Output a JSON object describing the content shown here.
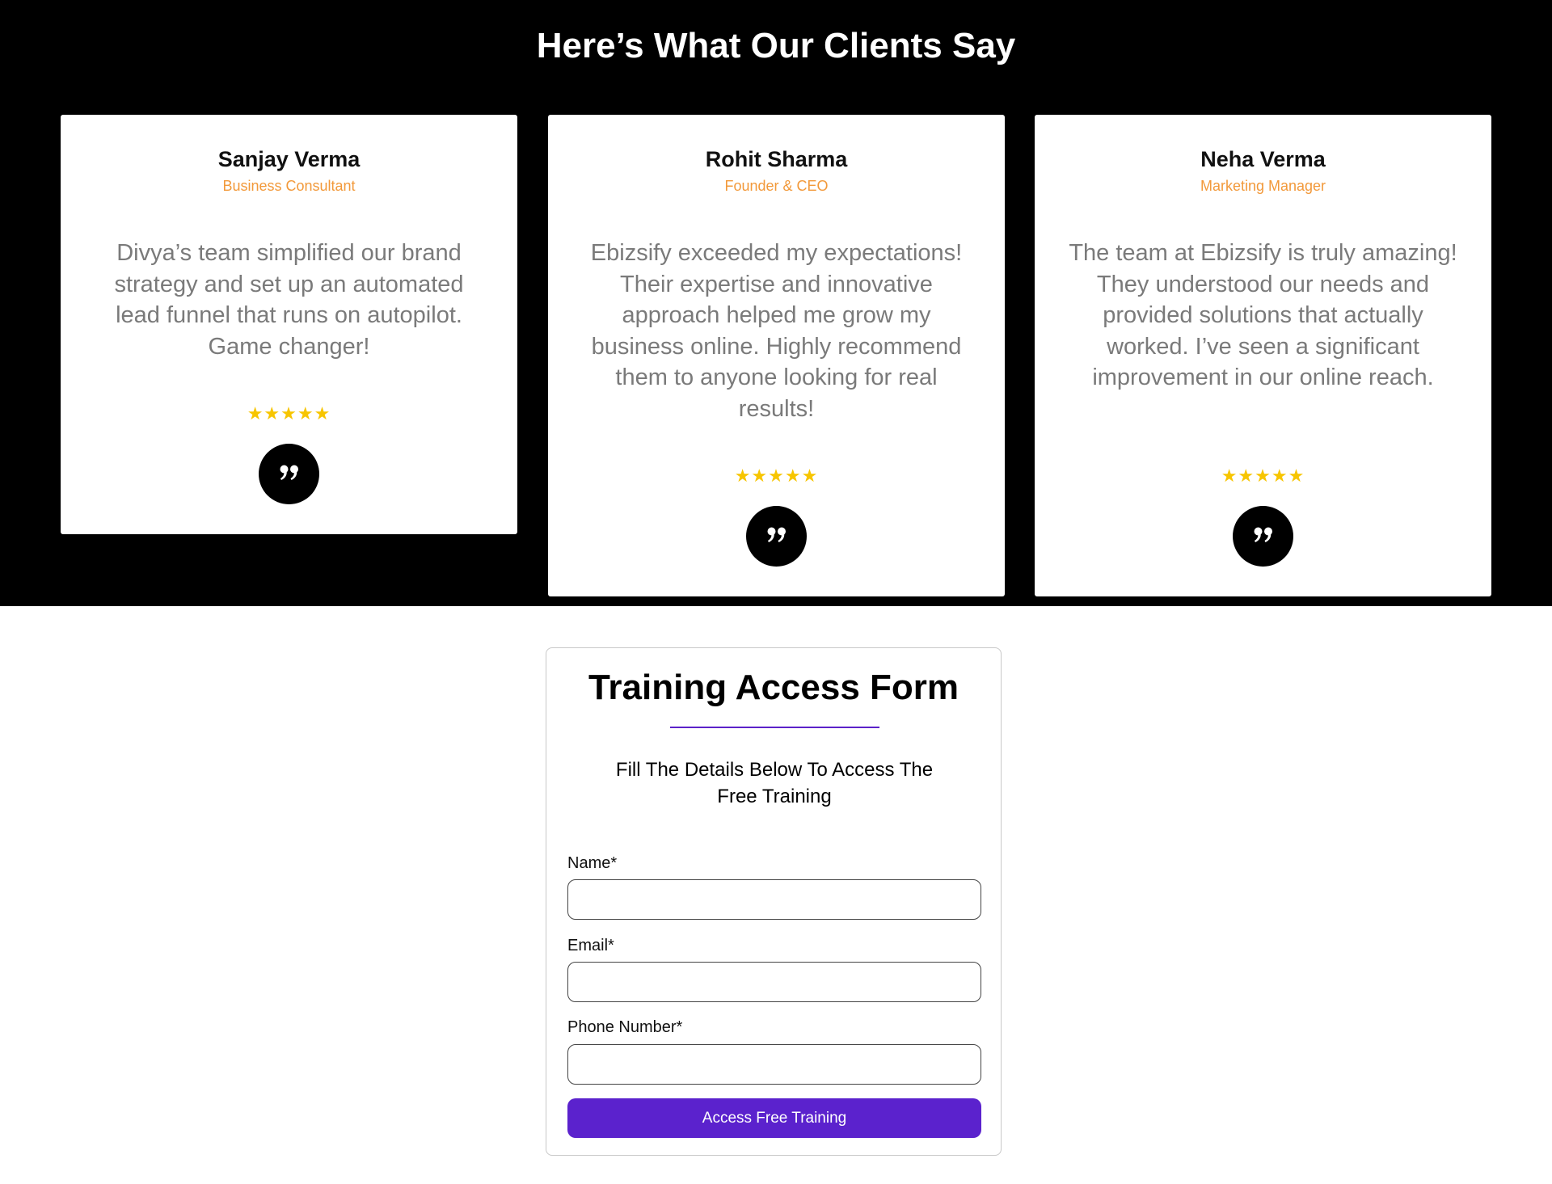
{
  "testimonials": {
    "title": "Here’s What Our Clients Say",
    "items": [
      {
        "name": "Sanjay Verma",
        "role": "Business Consultant",
        "quote": "Divya’s team simplified our brand strategy and set up an automated lead funnel that runs on autopilot. Game changer!",
        "rating": 5,
        "stars": "★★★★★"
      },
      {
        "name": "Rohit Sharma",
        "role": "Founder & CEO",
        "quote": "Ebizsify exceeded my expectations! Their expertise and innovative approach helped me grow my business online. Highly recommend them to anyone looking for real results!",
        "rating": 5,
        "stars": "★★★★★"
      },
      {
        "name": "Neha Verma",
        "role": "Marketing Manager",
        "quote": "The team at Ebizsify is truly amazing! They understood our needs and provided solutions that actually worked. I’ve seen a significant improvement in our online reach.",
        "rating": 5,
        "stars": "★★★★★"
      }
    ]
  },
  "form": {
    "title": "Training Access Form",
    "subtitle": "Fill The Details Below To Access The Free Training",
    "name_label": "Name*",
    "name_value": "",
    "email_label": "Email*",
    "email_value": "",
    "phone_label": "Phone Number*",
    "phone_value": "",
    "submit_label": "Access Free Training"
  },
  "colors": {
    "accent": "#5b22cd",
    "role_text": "#f2993a",
    "stars": "#f7c500",
    "dark_background": "#000000"
  },
  "icons": {
    "quote": "quote-icon",
    "star": "star-icon"
  }
}
